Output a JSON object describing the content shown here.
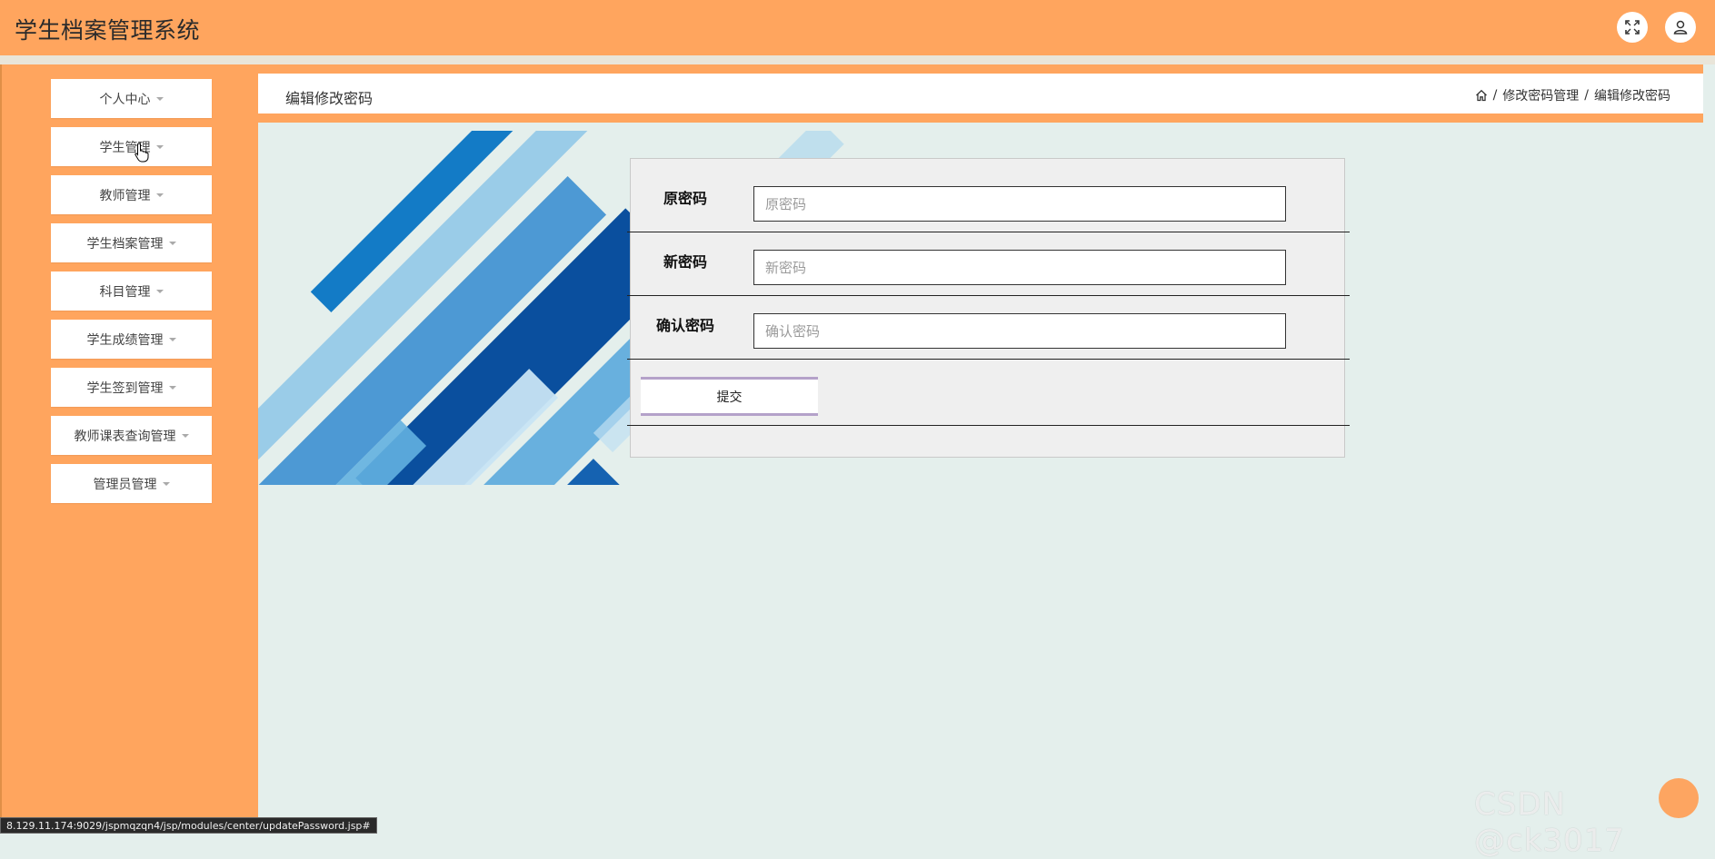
{
  "app": {
    "title": "学生档案管理系统"
  },
  "header": {
    "icons": [
      "fullscreen-icon",
      "user-icon"
    ]
  },
  "sidebar": {
    "items": [
      {
        "label": "个人中心"
      },
      {
        "label": "学生管理"
      },
      {
        "label": "教师管理"
      },
      {
        "label": "学生档案管理"
      },
      {
        "label": "科目管理"
      },
      {
        "label": "学生成绩管理"
      },
      {
        "label": "学生签到管理"
      },
      {
        "label": "教师课表查询管理"
      },
      {
        "label": "管理员管理"
      }
    ]
  },
  "page": {
    "title": "编辑修改密码",
    "breadcrumb": [
      "修改密码管理",
      "编辑修改密码"
    ]
  },
  "form": {
    "fields": [
      {
        "label": "原密码",
        "placeholder": "原密码",
        "value": ""
      },
      {
        "label": "新密码",
        "placeholder": "新密码",
        "value": ""
      },
      {
        "label": "确认密码",
        "placeholder": "确认密码",
        "value": ""
      }
    ],
    "submit_label": "提交"
  },
  "status": {
    "url": "8.129.11.174:9029/jspmqzqn4/jsp/modules/center/updatePassword.jsp#"
  },
  "watermark": {
    "text": "CSDN @ck3017"
  },
  "colors": {
    "primary": "#ffa55e",
    "background": "#e4efec",
    "banner_blue": "#0a4f9e"
  }
}
